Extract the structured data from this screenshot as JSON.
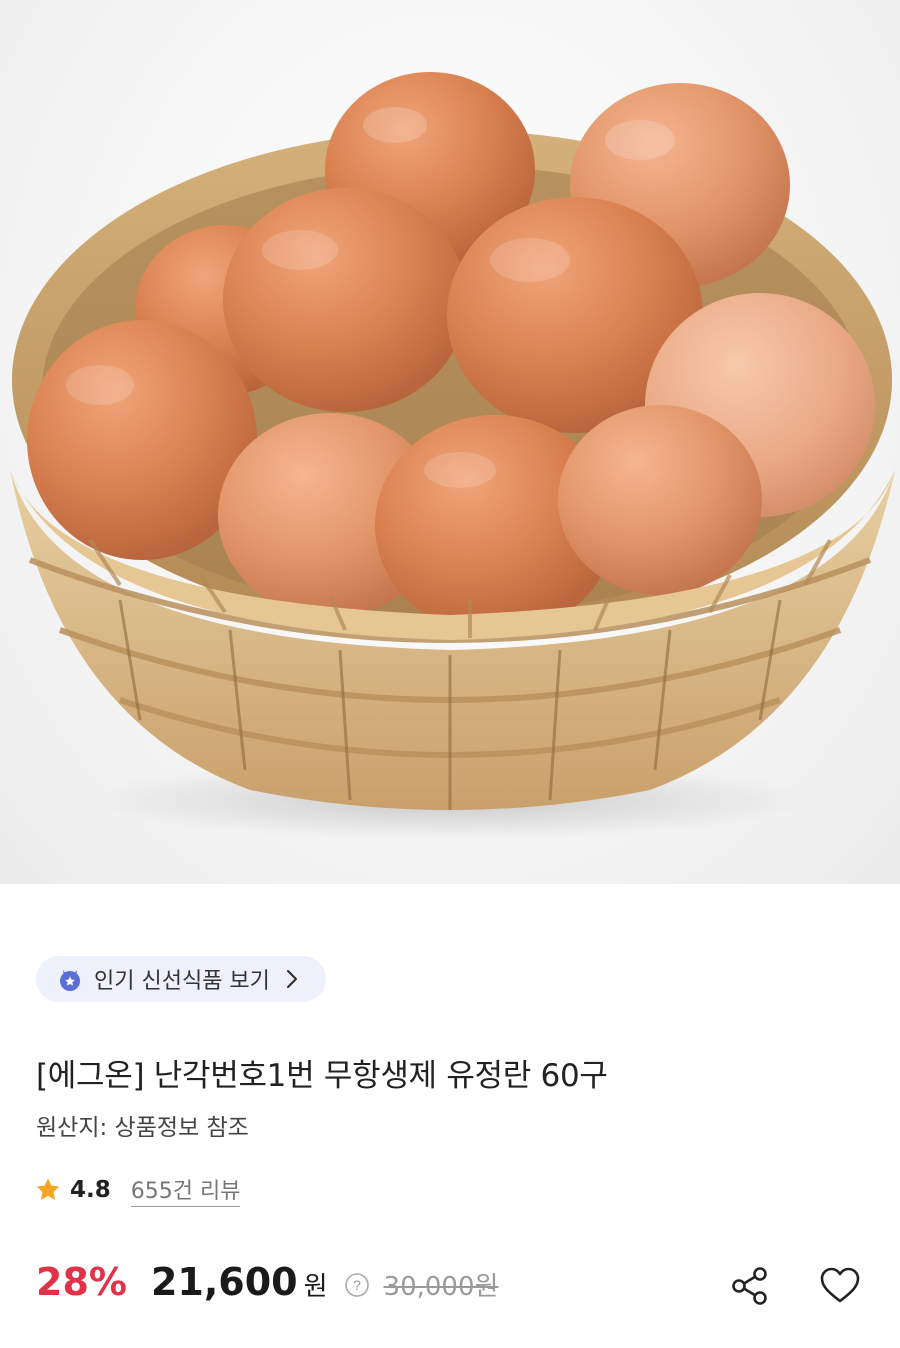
{
  "product_image": {
    "alt": "달걀 바구니 이미지"
  },
  "category_chip": {
    "label": "인기 신선식품 보기",
    "icon": "fresh-food-badge-icon",
    "arrow_icon": "chevron-right-icon"
  },
  "product": {
    "title": "[에그온] 난각번호1번 무항생제 유정란 60구",
    "origin": "원산지: 상품정보 참조"
  },
  "rating": {
    "star_icon": "star-icon",
    "value": "4.8",
    "review_link": "655건 리뷰",
    "star_color": "#f5a623"
  },
  "price": {
    "discount": "28%",
    "sale_price": "21,600",
    "currency": "원",
    "help_icon": "question-circle-icon",
    "original_price": "30,000원",
    "discount_color": "#e0334a"
  },
  "actions": {
    "share_icon": "share-icon",
    "like_icon": "heart-icon"
  }
}
